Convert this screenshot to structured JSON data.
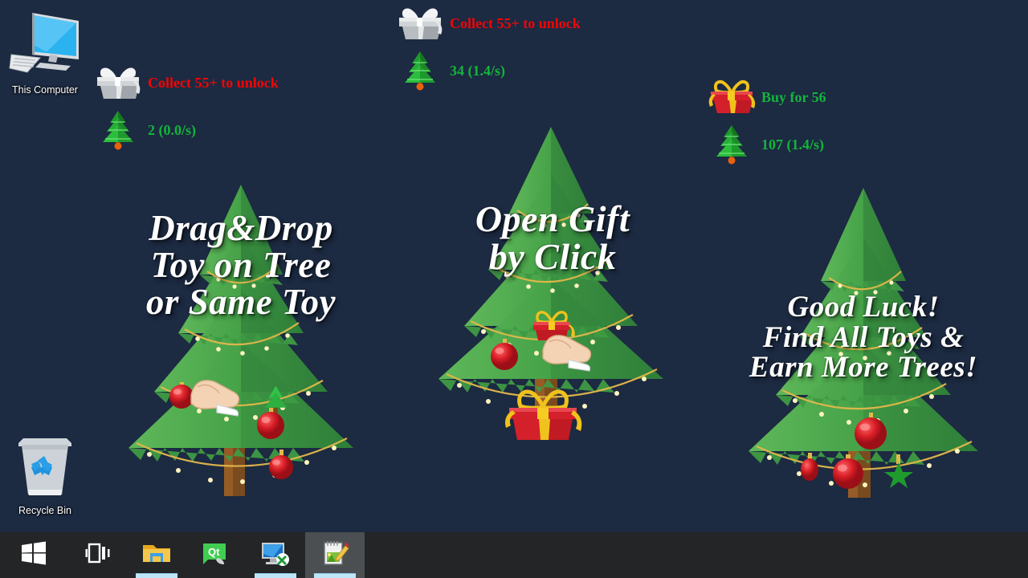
{
  "desktop": {
    "background_color": "#1c2a42",
    "icons": [
      {
        "name": "this-computer",
        "label": "This Computer",
        "icon": "monitor-icon"
      },
      {
        "name": "recycle-bin",
        "label": "Recycle Bin",
        "icon": "recycle-bin-icon"
      }
    ]
  },
  "colors": {
    "locked_text": "#f20505",
    "buy_text": "#12b53a",
    "count_text": "#12b53a",
    "caption_text": "#ffffff",
    "taskbar": "#232527",
    "taskbar_active": "#4c4f52",
    "taskbar_underline": "#bfe6f7"
  },
  "shop": {
    "left": {
      "gift_icon": "gift-box-gray-icon",
      "status_label": "Collect 55+ to unlock",
      "status_state": "locked",
      "tree_icon": "christmas-tree-small-icon",
      "count_label": "2 (0.0/s)",
      "count_value": 2,
      "rate_value": "0.0/s"
    },
    "center": {
      "gift_icon": "gift-box-gray-icon",
      "status_label": "Collect 55+ to unlock",
      "status_state": "locked",
      "tree_icon": "christmas-tree-small-icon",
      "count_label": "34 (1.4/s)",
      "count_value": 34,
      "rate_value": "1.4/s"
    },
    "right": {
      "gift_icon": "gift-box-red-icon",
      "status_label": "Buy for 56",
      "status_state": "buyable",
      "tree_icon": "christmas-tree-small-icon",
      "count_label": "107 (1.4/s)",
      "count_value": 107,
      "rate_value": "1.4/s"
    }
  },
  "trees": {
    "left": {
      "caption": "Drag&Drop\nToy on Tree\nor Same Toy",
      "has_hand_cursor": true,
      "ornaments": 3
    },
    "center": {
      "caption": "Open Gift\nby Click",
      "has_hand_cursor": true,
      "ornaments": 1,
      "gift_under_tree": true
    },
    "right": {
      "caption": "Good Luck!\nFind All Toys &\nEarn More Trees!",
      "has_hand_cursor": false,
      "ornaments": 4
    }
  },
  "taskbar": {
    "items": [
      {
        "name": "start-button",
        "icon": "windows-logo-icon",
        "active": false,
        "open": false,
        "label": "Start"
      },
      {
        "name": "task-view-button",
        "icon": "task-view-icon",
        "active": false,
        "open": false,
        "label": "Task View"
      },
      {
        "name": "file-explorer",
        "icon": "folder-icon",
        "active": false,
        "open": true,
        "label": "File Explorer"
      },
      {
        "name": "qt-creator",
        "icon": "qt-logo-icon",
        "active": false,
        "open": false,
        "label": "Qt Creator"
      },
      {
        "name": "remote-desktop",
        "icon": "remote-desktop-icon",
        "active": false,
        "open": true,
        "label": "Remote Desktop"
      },
      {
        "name": "notepad-editor",
        "icon": "notepad-edit-icon",
        "active": true,
        "open": true,
        "label": "Editor"
      }
    ]
  }
}
